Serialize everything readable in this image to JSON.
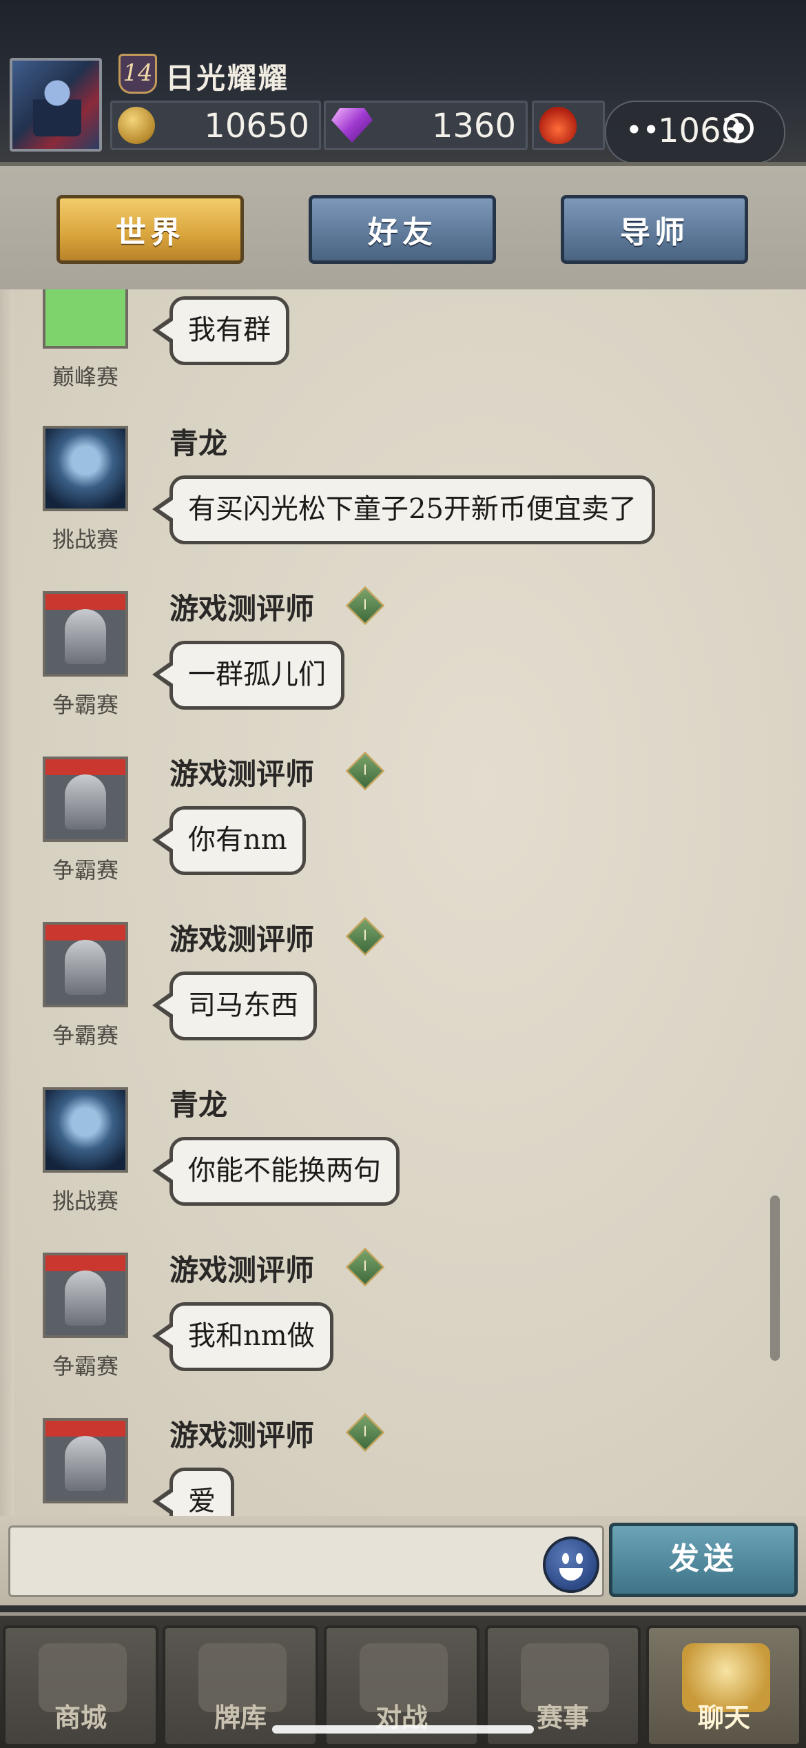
{
  "header": {
    "level": "14",
    "player_name": "日光耀耀",
    "gold": "10650",
    "gems": "1360",
    "potion_capsule_value": "1063"
  },
  "tabs": [
    {
      "label": "世界",
      "active": true
    },
    {
      "label": "好友",
      "active": false
    },
    {
      "label": "导师",
      "active": false
    }
  ],
  "messages": [
    {
      "sender": "",
      "rank": "",
      "tag": "巅峰赛",
      "text": "我有群"
    },
    {
      "sender": "青龙",
      "rank": "",
      "tag": "挑战赛",
      "text": "有买闪光松下童子25开新币便宜卖了"
    },
    {
      "sender": "游戏测评师",
      "rank": "I",
      "tag": "争霸赛",
      "text": "一群孤儿们"
    },
    {
      "sender": "游戏测评师",
      "rank": "I",
      "tag": "争霸赛",
      "text": "你有nm"
    },
    {
      "sender": "游戏测评师",
      "rank": "I",
      "tag": "争霸赛",
      "text": "司马东西"
    },
    {
      "sender": "青龙",
      "rank": "",
      "tag": "挑战赛",
      "text": "你能不能换两句"
    },
    {
      "sender": "游戏测评师",
      "rank": "I",
      "tag": "争霸赛",
      "text": "我和nm做"
    },
    {
      "sender": "游戏测评师",
      "rank": "I",
      "tag": "",
      "text": "爱"
    }
  ],
  "input": {
    "placeholder": "",
    "value": ""
  },
  "send_label": "发送",
  "bottom_nav": [
    {
      "label": "商城",
      "icon": "shop-icon",
      "active": false
    },
    {
      "label": "牌库",
      "icon": "cards-icon",
      "active": false
    },
    {
      "label": "对战",
      "icon": "battle-icon",
      "active": false
    },
    {
      "label": "赛事",
      "icon": "trophy-icon",
      "active": false
    },
    {
      "label": "聊天",
      "icon": "chat-fist-icon",
      "active": true
    }
  ],
  "colors": {
    "tab_active": "#d9a43c",
    "tab_inactive": "#5d7898",
    "send_button": "#4f8aa0",
    "panel_bg": "#d8d2c3"
  }
}
